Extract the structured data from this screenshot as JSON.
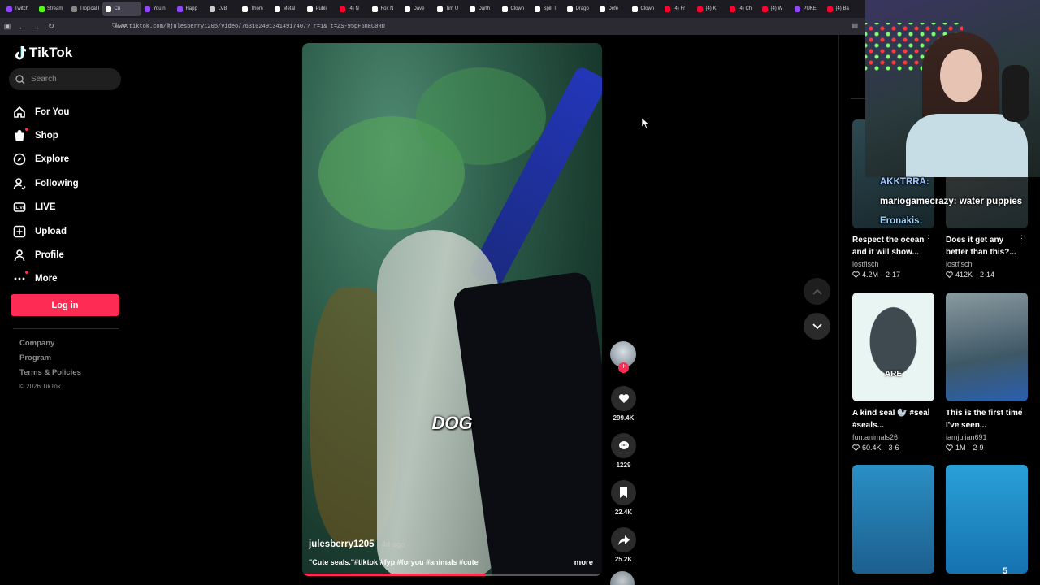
{
  "browser": {
    "tabs": [
      {
        "label": "Twitch",
        "color": "#9146ff"
      },
      {
        "label": "Stream",
        "color": "#53fc18"
      },
      {
        "label": "Tropical I",
        "color": "#888888"
      },
      {
        "label": "Cu",
        "color": "#ffffff",
        "active": true
      },
      {
        "label": "You n",
        "color": "#9146ff"
      },
      {
        "label": "Happ",
        "color": "#9146ff"
      },
      {
        "label": "LVB",
        "color": "#cccccc"
      },
      {
        "label": "Thom",
        "color": "#ffffff"
      },
      {
        "label": "Metal",
        "color": "#ffffff"
      },
      {
        "label": "Publi",
        "color": "#ffffff"
      },
      {
        "label": "(4) N",
        "color": "#ff0033"
      },
      {
        "label": "Fox N",
        "color": "#ffffff"
      },
      {
        "label": "Dave",
        "color": "#ffffff"
      },
      {
        "label": "Tim U",
        "color": "#ffffff"
      },
      {
        "label": "Darth",
        "color": "#ffffff"
      },
      {
        "label": "Clown",
        "color": "#ffffff"
      },
      {
        "label": "Spill T",
        "color": "#ffffff"
      },
      {
        "label": "Drago",
        "color": "#ffffff"
      },
      {
        "label": "Defe",
        "color": "#ffffff"
      },
      {
        "label": "Clown",
        "color": "#ffffff"
      },
      {
        "label": "(4) Fr",
        "color": "#ff0033"
      },
      {
        "label": "(4) K",
        "color": "#ff0033"
      },
      {
        "label": "(4) Ch",
        "color": "#ff0033"
      },
      {
        "label": "(4) W",
        "color": "#ff0033"
      },
      {
        "label": "PUKE",
        "color": "#9146ff"
      },
      {
        "label": "(4) Ba",
        "color": "#ff0033"
      }
    ],
    "url": "www.tiktok.com/@julesberry1205/video/7631024913414917407?_r=1&_t=ZS-95pF6nEC0RU"
  },
  "sidebar": {
    "brand": "TikTok",
    "search_placeholder": "Search",
    "nav": [
      {
        "label": "For You",
        "icon": "home-icon"
      },
      {
        "label": "Shop",
        "icon": "shopping-bag-icon",
        "dot": true
      },
      {
        "label": "Explore",
        "icon": "compass-icon"
      },
      {
        "label": "Following",
        "icon": "following-icon"
      },
      {
        "label": "LIVE",
        "icon": "live-icon"
      },
      {
        "label": "Upload",
        "icon": "upload-icon"
      },
      {
        "label": "Profile",
        "icon": "profile-icon"
      },
      {
        "label": "More",
        "icon": "more-icon",
        "dot": true
      }
    ],
    "login_label": "Log in",
    "footer": [
      "Company",
      "Program",
      "Terms & Policies"
    ],
    "copyright": "© 2026 TikTok"
  },
  "video": {
    "overlay_word": "DOG",
    "author": "julesberry1205",
    "posted": "· 4d ago",
    "description": "\"Cute seals.\"#tiktok #fyp #foryou #animals #cute",
    "more_label": "more",
    "progress": 0.61
  },
  "actions": {
    "likes": "299.4K",
    "comments": "1229",
    "saves": "22.4K",
    "shares": "25.2K"
  },
  "recommendations": [
    {
      "title": "Respect the ocean and it will show...",
      "user": "lostfisch",
      "likes": "4.2M",
      "date": "2-17"
    },
    {
      "title": "Does it get any better than this?...",
      "user": "lostfisch",
      "likes": "412K",
      "date": "2-14"
    },
    {
      "title": "A kind seal 🦭 #seal #seals...",
      "user": "fun.animals26",
      "likes": "60.4K",
      "date": "3-6",
      "overlay": "ARE"
    },
    {
      "title": "This is the first time I've seen...",
      "user": "iamjulian691",
      "likes": "1M",
      "date": "2-9"
    },
    {
      "title": "",
      "user": "",
      "likes": "",
      "date": ""
    },
    {
      "title": "",
      "user": "",
      "likes": "",
      "date": ""
    }
  ],
  "stream_chat": [
    {
      "name": "AKKTRRA:",
      "text": ""
    },
    {
      "name": "mariogamecrazy:",
      "text": "water puppies"
    },
    {
      "name": "Eronakis:",
      "text": ""
    }
  ],
  "viewer_badge": "5"
}
